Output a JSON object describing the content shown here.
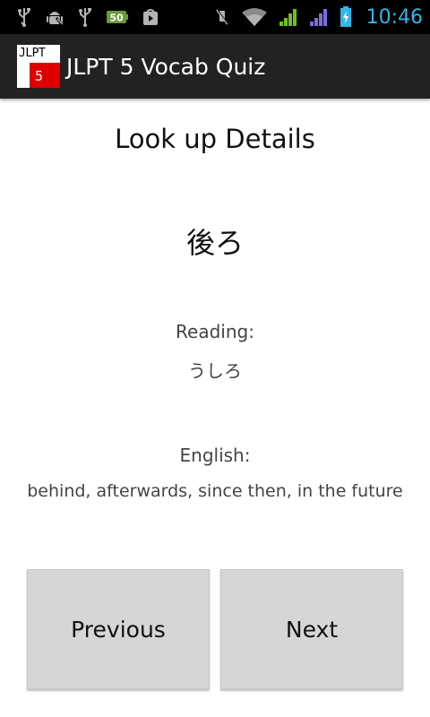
{
  "status_bar": {
    "battery_level_badge": "50",
    "time": "10:46",
    "icons": [
      "usb-icon",
      "android-debug-icon",
      "usb-icon",
      "battery-level-badge-icon",
      "play-store-icon",
      "mute-icon",
      "wifi-icon",
      "signal-icon",
      "signal-icon",
      "battery-charging-icon"
    ],
    "accent_color": "#33b5e5"
  },
  "action_bar": {
    "icon_text_line1": "JLPT",
    "icon_text_line2": "5",
    "title": "JLPT 5 Vocab Quiz"
  },
  "main": {
    "heading": "Look up Details",
    "word": "後ろ",
    "reading_label": "Reading:",
    "reading_value": "うしろ",
    "english_label": "English:",
    "english_value": "behind, afterwards, since then, in the future"
  },
  "buttons": {
    "previous_label": "Previous",
    "next_label": "Next"
  }
}
